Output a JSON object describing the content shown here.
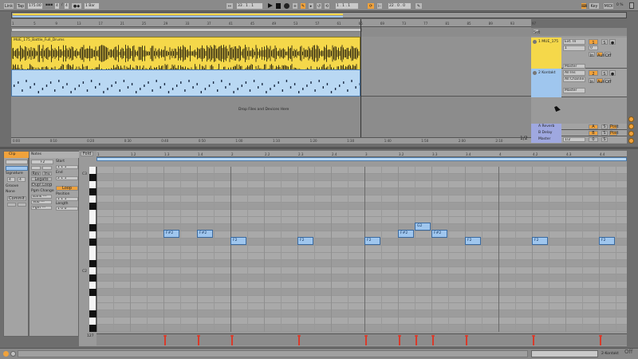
{
  "toolbar": {
    "link_label": "Link",
    "tap_label": "Tap",
    "tempo": "175.00",
    "sig_num": "4",
    "sig_den": "4",
    "quant": "1 Bar",
    "position": "33 . 1 . 1",
    "loop_start": "1 . 1 . 1",
    "loop_length": "22 . 0 . 0",
    "key_label": "Key",
    "midi_label": "MIDI",
    "cpu": "0 %"
  },
  "arrangement": {
    "ruler_marks": [
      "1",
      "5",
      "9",
      "13",
      "17",
      "21",
      "25",
      "29",
      "33",
      "37",
      "41",
      "45",
      "49",
      "53",
      "57",
      "61",
      "65",
      "69",
      "73",
      "77",
      "81",
      "85",
      "89",
      "93",
      "97"
    ],
    "time_marks": [
      "0:00",
      "0:10",
      "0:20",
      "0:30",
      "0:40",
      "0:50",
      "1:00",
      "1:10",
      "1:20",
      "1:30",
      "1:40",
      "1:50",
      "2:00",
      "2:10"
    ],
    "audio_clip_name": "MUE_175_Battle_Full_Drums",
    "drop_hint": "Drop Files and Devices Here",
    "zoom": "1/2"
  },
  "tracks": [
    {
      "name": "1 MUE_175",
      "color": "#f5d84a",
      "input": "Ext. In",
      "channel": "1",
      "output": "Master",
      "num": "1"
    },
    {
      "name": "2 Kontakt",
      "color": "#9fc6ee",
      "input": "All Ins",
      "channel": "All Channe",
      "output": "Master",
      "num": "2",
      "monitor": "Auto"
    }
  ],
  "returns": [
    {
      "name": "A Reverb",
      "letter": "A"
    },
    {
      "name": "B Delay",
      "letter": "B"
    },
    {
      "name": "Master",
      "cue": "1/2",
      "num": "0"
    }
  ],
  "monitor": {
    "in": "In",
    "auto": "Auto",
    "off": "Off"
  },
  "clip_view": {
    "clip_tab": "Clip",
    "notes_tab": "Notes",
    "note_name": "F2",
    "start_label": "Start",
    "start_val": "1  1  1",
    "end_label": "End",
    "end_val": "2  1  1",
    "loop_label": "Loop",
    "position_label": "Position",
    "position_val": "1  1  1",
    "length_label": "Length",
    "length_val": "1  0  0",
    "signature_label": "Signature",
    "sig_num": "4",
    "sig_den": "4",
    "groove_label": "Groove",
    "groove_val": "None",
    "commit_label": "Commit",
    "rev_label": "Rev",
    "inv_label": "Inv",
    "legato_label": "Legato",
    "dupl_loop_label": "Dupl.Loop",
    "pgm_change_label": "Pgm Change",
    "bank_label": "Bank ---",
    "sub_label": "Sub ---",
    "pgm_label": "Pgm ---",
    "fold_label": "Fold"
  },
  "piano_roll": {
    "bar_marks": [
      "1",
      "1.2",
      "1.3",
      "1.4",
      "2",
      "2.2",
      "2.3",
      "2.4",
      "3",
      "3.2",
      "3.3",
      "3.4",
      "4",
      "4.2",
      "4.3",
      "4.4"
    ],
    "key_labels": [
      "C3",
      "C2"
    ],
    "velocity_label": "127",
    "notes": [
      {
        "pitch": "F#2",
        "start": 1.25
      },
      {
        "pitch": "F#2",
        "start": 1.5
      },
      {
        "pitch": "F2",
        "start": 1.75
      },
      {
        "pitch": "F2",
        "start": 2.25
      },
      {
        "pitch": "F2",
        "start": 2.75
      },
      {
        "pitch": "F#2",
        "start": 3.0
      },
      {
        "pitch": "G2",
        "start": 3.125
      },
      {
        "pitch": "F#2",
        "start": 3.25
      },
      {
        "pitch": "F2",
        "start": 3.5
      },
      {
        "pitch": "F2",
        "start": 4.0
      },
      {
        "pitch": "F2",
        "start": 4.5
      }
    ]
  },
  "status": {
    "track_name": "2-Kontakt",
    "off_label": "Off"
  },
  "colors": {
    "audio": "#f5d84a",
    "midi": "#9fc6ee",
    "accent": "#f0a23c",
    "velocity": "#d93a2a"
  }
}
